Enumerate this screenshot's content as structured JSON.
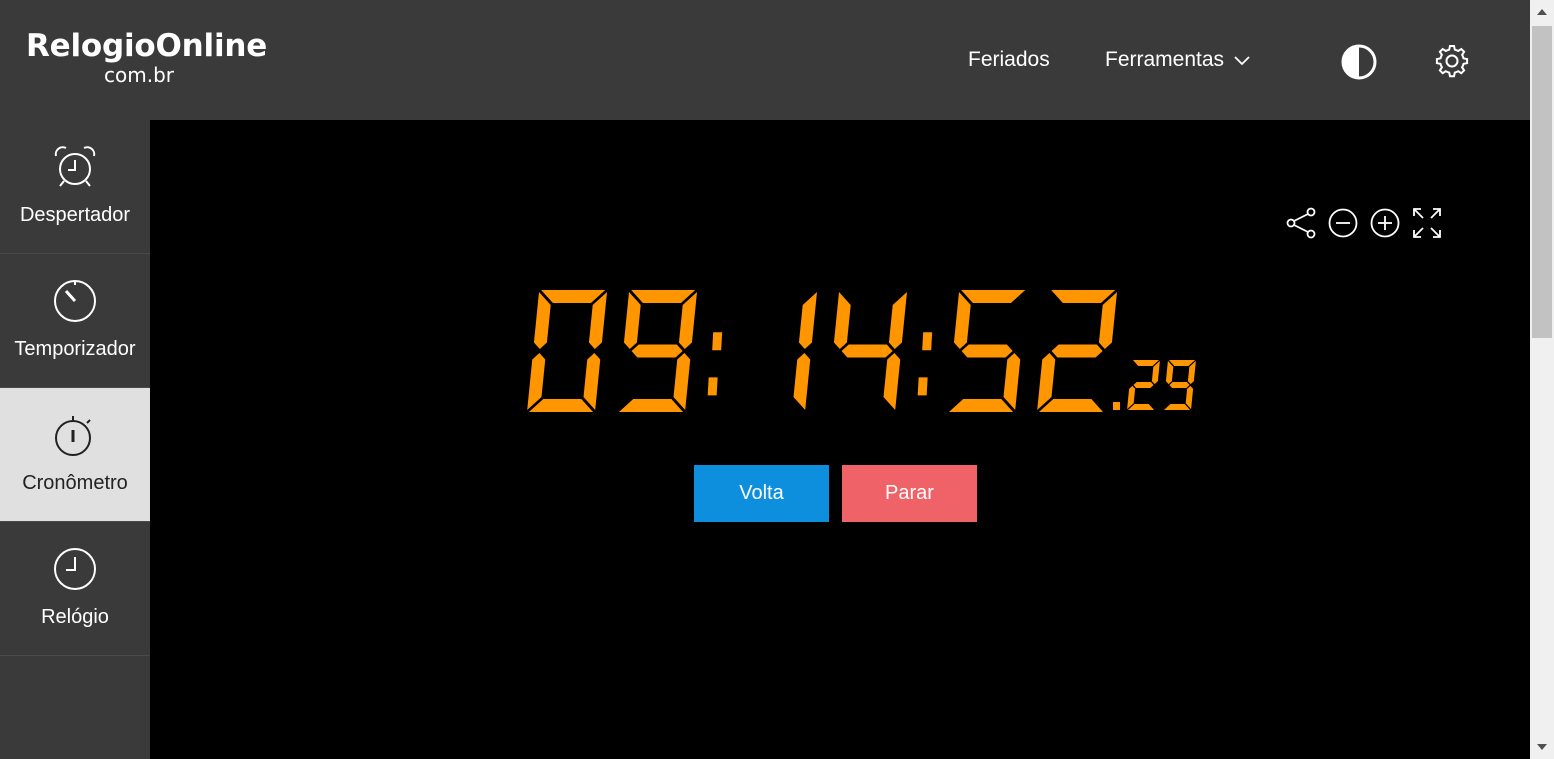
{
  "header": {
    "logo_main": "RelogioOnline",
    "logo_sub": "com.br",
    "nav_feriados": "Feriados",
    "nav_ferramentas": "Ferramentas",
    "contrast_icon": "contrast-icon",
    "settings_icon": "gear-icon"
  },
  "sidebar": {
    "items": [
      {
        "label": "Despertador",
        "icon": "alarm-clock-icon",
        "active": false
      },
      {
        "label": "Temporizador",
        "icon": "timer-icon",
        "active": false
      },
      {
        "label": "Cronômetro",
        "icon": "stopwatch-icon",
        "active": true
      },
      {
        "label": "Relógio",
        "icon": "clock-icon",
        "active": false
      }
    ]
  },
  "toolbar": {
    "icons": [
      "share-icon",
      "zoom-out-icon",
      "zoom-in-icon",
      "fullscreen-icon"
    ]
  },
  "stopwatch": {
    "time": "09:14:52",
    "hundredths": "29",
    "digit_color": "#ff9600"
  },
  "buttons": {
    "lap_label": "Volta",
    "stop_label": "Parar",
    "lap_color": "#0d8fde",
    "stop_color": "#ef6368"
  }
}
